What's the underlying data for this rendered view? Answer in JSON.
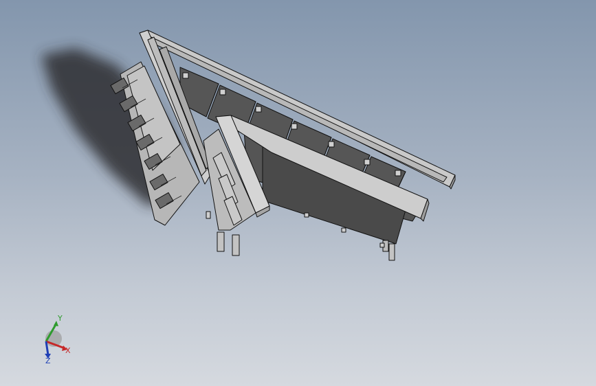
{
  "viewport": {
    "background_top": "#8396ad",
    "background_bottom": "#d5d9df",
    "model_fill": "#c8c8c8",
    "model_edge": "#111111",
    "panel_dark": "#555555",
    "shadow": "#333333"
  },
  "triad": {
    "x_label": "X",
    "y_label": "Y",
    "z_label": "Z",
    "x_color": "#c62828",
    "y_color": "#2e9b2e",
    "z_color": "#1f3fb5"
  }
}
